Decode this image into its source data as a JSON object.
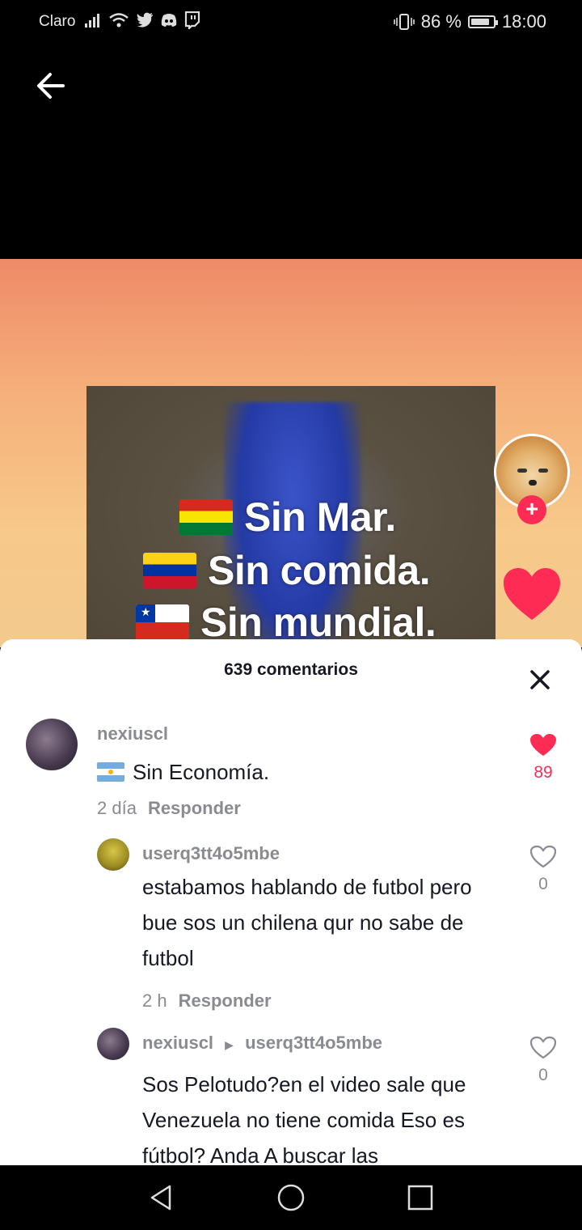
{
  "status_bar": {
    "carrier": "Claro",
    "battery_percent": "86 %",
    "battery_level": 0.86,
    "time": "18:00",
    "icons": [
      "signal-icon",
      "wifi-icon",
      "twitter-icon",
      "discord-icon",
      "twitch-icon",
      "vibrate-icon",
      "battery-icon"
    ]
  },
  "video": {
    "meme_lines": [
      {
        "flag": "bolivia-flag-icon",
        "text": "Sin Mar."
      },
      {
        "flag": "venezuela-flag-icon",
        "text": "Sin comida."
      },
      {
        "flag": "chile-flag-icon",
        "text": "Sin mundial."
      }
    ],
    "follow_label": "+"
  },
  "comments_sheet": {
    "title": "639 comentarios",
    "comments": [
      {
        "user": "nexiuscl",
        "flag": "argentina-flag-icon",
        "text": "Sin Economía.",
        "time": "2 día",
        "reply_label": "Responder",
        "likes": "89",
        "liked": true
      },
      {
        "user": "userq3tt4o5mbe",
        "text": "estabamos hablando de futbol pero bue sos un chilena qur no sabe de futbol",
        "time": "2 h",
        "reply_label": "Responder",
        "likes": "0",
        "liked": false
      },
      {
        "user": "nexiuscl",
        "reply_to": "userq3tt4o5mbe",
        "text": "Sos Pelotudo?en el video sale que Venezuela no tiene comida Eso es fútbol? Anda A buscar las",
        "likes": "0",
        "liked": false
      }
    ]
  },
  "colors": {
    "accent": "#fe2c55",
    "muted": "#8a8b91",
    "text": "#161823"
  }
}
